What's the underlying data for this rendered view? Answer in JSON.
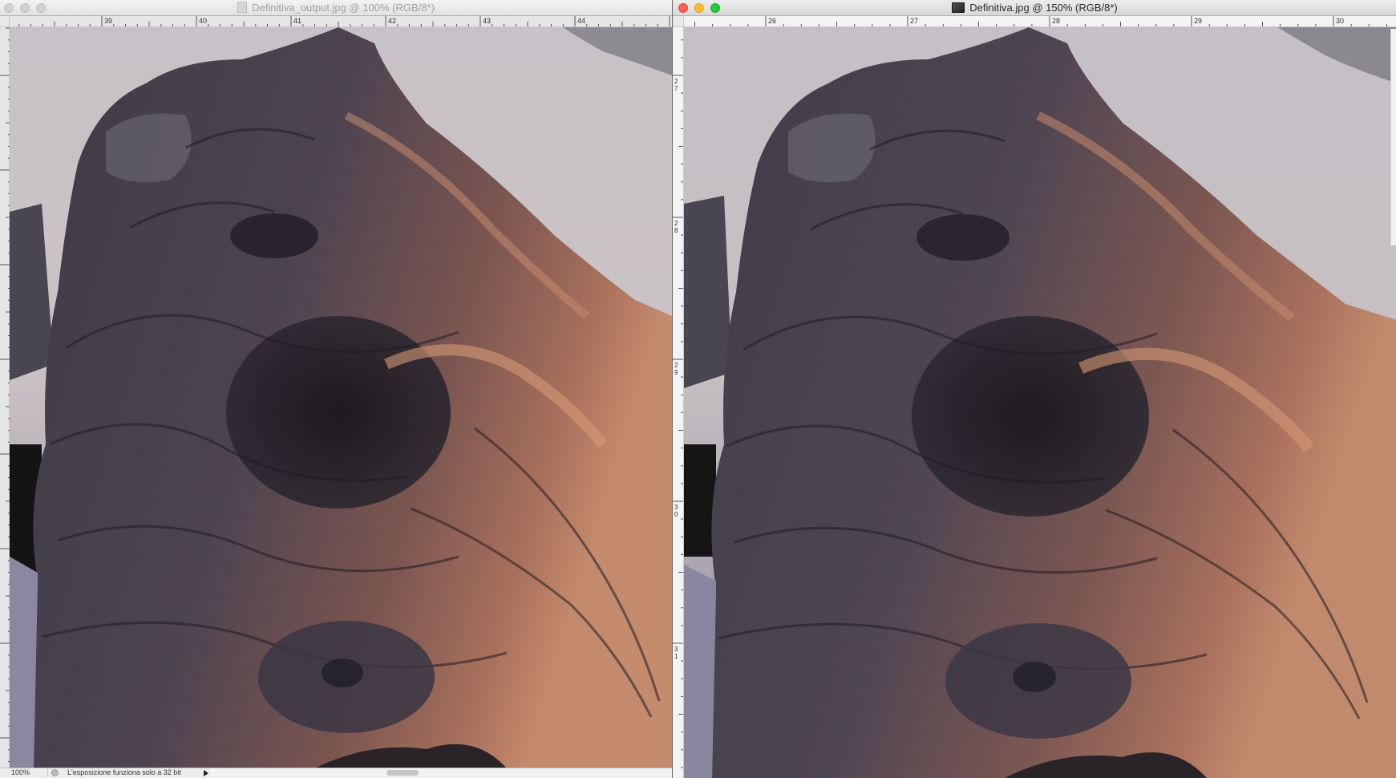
{
  "left_window": {
    "title": "Definitiva_output.jpg @ 100% (RGB/8*)",
    "ruler_top_labels": [
      "39",
      "40",
      "41",
      "42",
      "43",
      "44"
    ],
    "statusbar": {
      "zoom": "100%",
      "message": "L'esposizione funziona solo a 32 bit"
    }
  },
  "right_window": {
    "title": "Definitiva.jpg @ 150% (RGB/8*)",
    "ruler_top_labels": [
      "26",
      "27",
      "28",
      "29",
      "30"
    ],
    "ruler_left_labels": [
      "27",
      "28",
      "29",
      "30",
      "31"
    ]
  },
  "colors": {
    "close": "#fe5f57",
    "minimize": "#febb2e",
    "zoom": "#28c840"
  },
  "icons": {
    "window_controls": [
      "close-icon",
      "minimize-icon",
      "zoom-icon"
    ],
    "left_document": "document-icon",
    "right_document": "image-document-icon"
  }
}
